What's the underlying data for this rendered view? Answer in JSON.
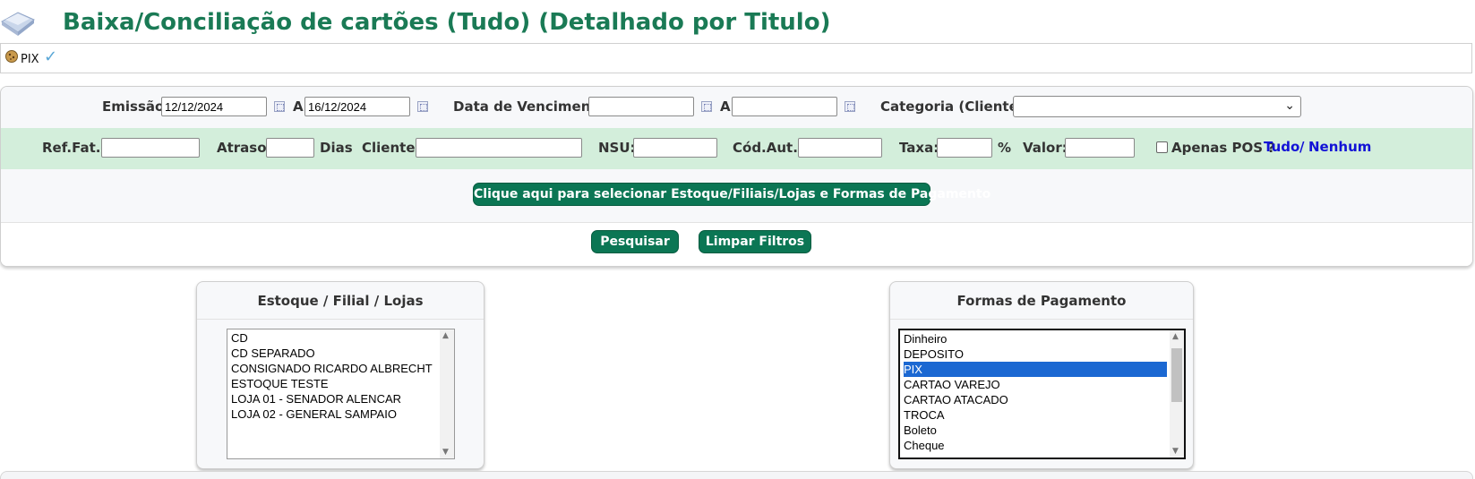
{
  "page": {
    "title": "Baixa/Conciliação de cartões (Tudo) (Detalhado por Titulo)",
    "accent_color": "#1a7a55",
    "icon": "folder-icon"
  },
  "tab": {
    "label": "PIX",
    "icon": "cookie-icon",
    "check_icon": "check-icon"
  },
  "filters": {
    "emissao_label": "Emissão:",
    "emissao_from": "12/12/2024",
    "a_label": "A",
    "emissao_to": "16/12/2024",
    "vencimento_label": "Data de Vencimento:",
    "vencimento_from": "",
    "vencimento_to": "",
    "categoria_label": "Categoria (Clientes):",
    "categoria_value": "",
    "reffat_label": "Ref.Fat.:",
    "atraso_label": "Atraso:",
    "dias_label": "Dias",
    "cliente_label": "Cliente:",
    "nsu_label": "NSU:",
    "codaut_label": "Cód.Aut.:",
    "taxa_label": "Taxa:",
    "percent_label": "%",
    "valor_label": "Valor:",
    "apenas_pos_label": "Apenas POS ?",
    "apenas_pos_checked": false,
    "tudo_link": "Tudo",
    "slash": "/",
    "nenhum_link": "Nenhum",
    "select_button": "Clique aqui para selecionar Estoque/Filiais/Lojas e Formas de Pagamento",
    "search_button": "Pesquisar",
    "clear_button": "Limpar Filtros",
    "button_color": "#0b7654",
    "row2_color": "#d3eedb"
  },
  "estoque": {
    "title": "Estoque / Filial / Lojas",
    "items": [
      "CD",
      "CD SEPARADO",
      "CONSIGNADO RICARDO ALBRECHT",
      "ESTOQUE TESTE",
      "LOJA 01 - SENADOR ALENCAR",
      "LOJA 02 - GENERAL SAMPAIO"
    ]
  },
  "formas": {
    "title": "Formas de Pagamento",
    "items": [
      "Dinheiro",
      "DEPOSITO",
      "PIX",
      "CARTAO VAREJO",
      "CARTAO ATACADO",
      "TROCA",
      "Boleto",
      "Cheque"
    ],
    "selected": "PIX",
    "selected_color": "#1b68d2",
    "scroll_position": 0.35
  }
}
